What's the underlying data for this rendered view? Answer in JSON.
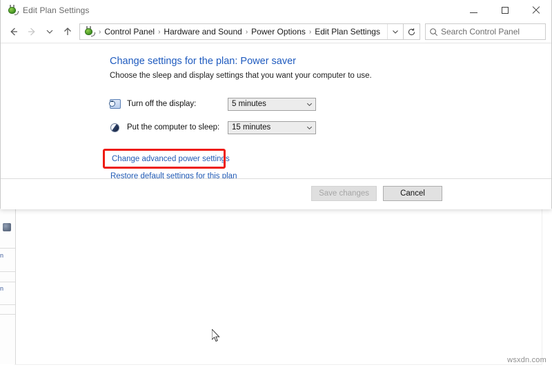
{
  "window": {
    "title": "Edit Plan Settings",
    "title_icon": "power-plug-icon",
    "controls": {
      "minimize": "Minimize",
      "maximize": "Maximize",
      "close": "Close"
    }
  },
  "navbar": {
    "back": "Back",
    "forward": "Forward",
    "recent_locations": "Recent locations",
    "up": "Up one level",
    "breadcrumb": [
      "Control Panel",
      "Hardware and Sound",
      "Power Options",
      "Edit Plan Settings"
    ],
    "breadcrumb_separator": "›",
    "breadcrumb_dropdown": "chevron-down-icon",
    "refresh": "Refresh",
    "search": {
      "placeholder": "Search Control Panel",
      "value": "",
      "icon": "search-icon"
    }
  },
  "content": {
    "heading": "Change settings for the plan: Power saver",
    "subheading": "Choose the sleep and display settings that you want your computer to use.",
    "settings": [
      {
        "icon": "display-clock-icon",
        "label": "Turn off the display:",
        "value": "5 minutes"
      },
      {
        "icon": "sleep-sphere-icon",
        "label": "Put the computer to sleep:",
        "value": "15 minutes"
      }
    ],
    "links": {
      "advanced": "Change advanced power settings",
      "restore": "Restore default settings for this plan"
    }
  },
  "footer": {
    "save_label": "Save changes",
    "save_enabled": false,
    "cancel_label": "Cancel"
  },
  "annotation": {
    "color": "#ee1b11",
    "target": "Change advanced power settings"
  },
  "watermark": {
    "text": "wsxdn.com"
  },
  "background": {
    "fragments": [
      "n",
      "n"
    ]
  }
}
